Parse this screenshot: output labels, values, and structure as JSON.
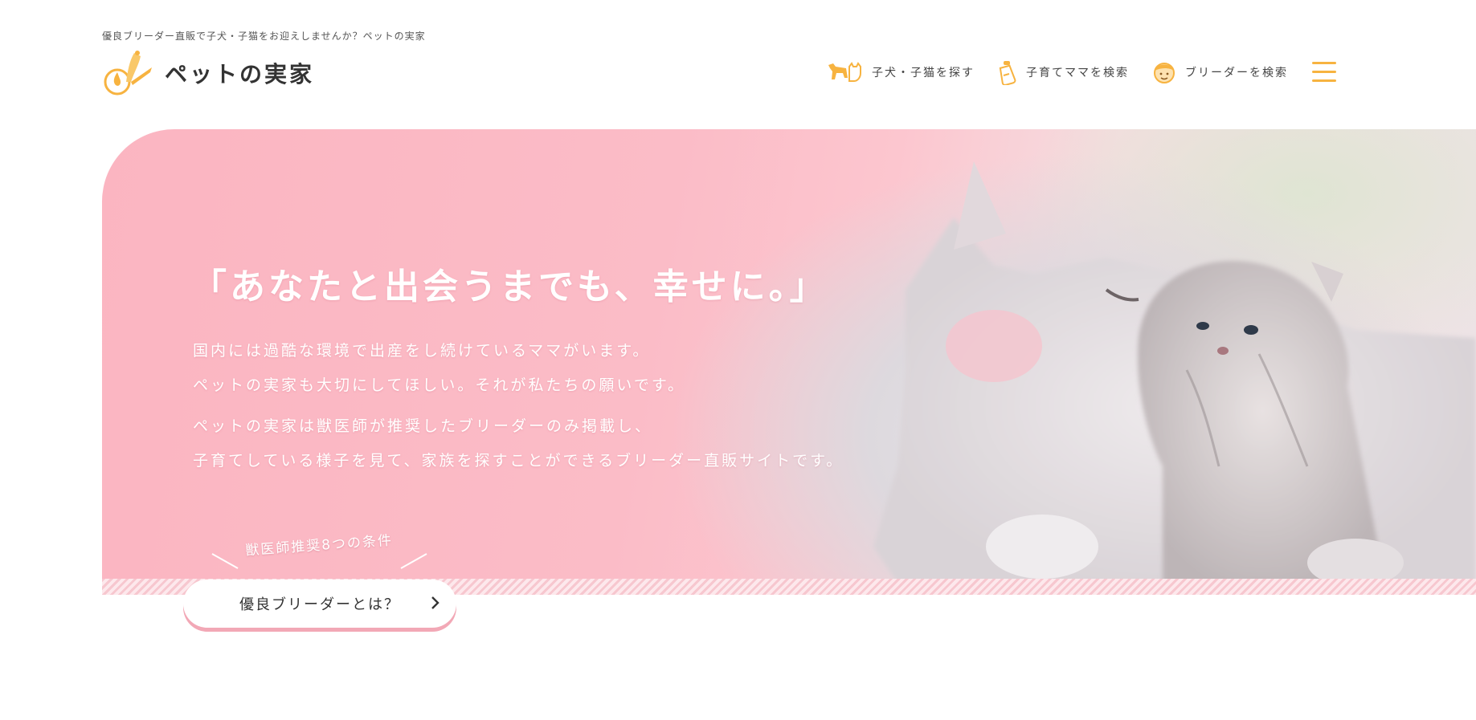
{
  "header": {
    "tagline": "優良ブリーダー直販で子犬・子猫をお迎えしませんか？ペットの実家",
    "logo_text": "ペットの実家",
    "nav": [
      {
        "label": "子犬・子猫を探す",
        "icon": "dog-cat-icon"
      },
      {
        "label": "子育てママを検索",
        "icon": "baby-bottle-icon"
      },
      {
        "label": "ブリーダーを検索",
        "icon": "breeder-face-icon"
      }
    ],
    "menu_icon": "hamburger-menu-icon"
  },
  "hero": {
    "title": "「あなたと出会うまでも、幸せに。」",
    "paragraph1": [
      "国内には過酷な環境で出産をし続けているママがいます。",
      "ペットの実家も大切にしてほしい。それが私たちの願いです。"
    ],
    "paragraph2": [
      "ペットの実家は獣医師が推奨したブリーダーのみ掲載し、",
      "子育てしている様子を見て、家族を探すことができるブリーダー直販サイトです。"
    ],
    "badge": "獣医師推奨8つの条件",
    "cta_label": "優良ブリーダーとは？"
  },
  "colors": {
    "accent": "#f7b340",
    "hero_pink": "#fbb5c1",
    "cta_shadow": "#f2a8b6"
  }
}
